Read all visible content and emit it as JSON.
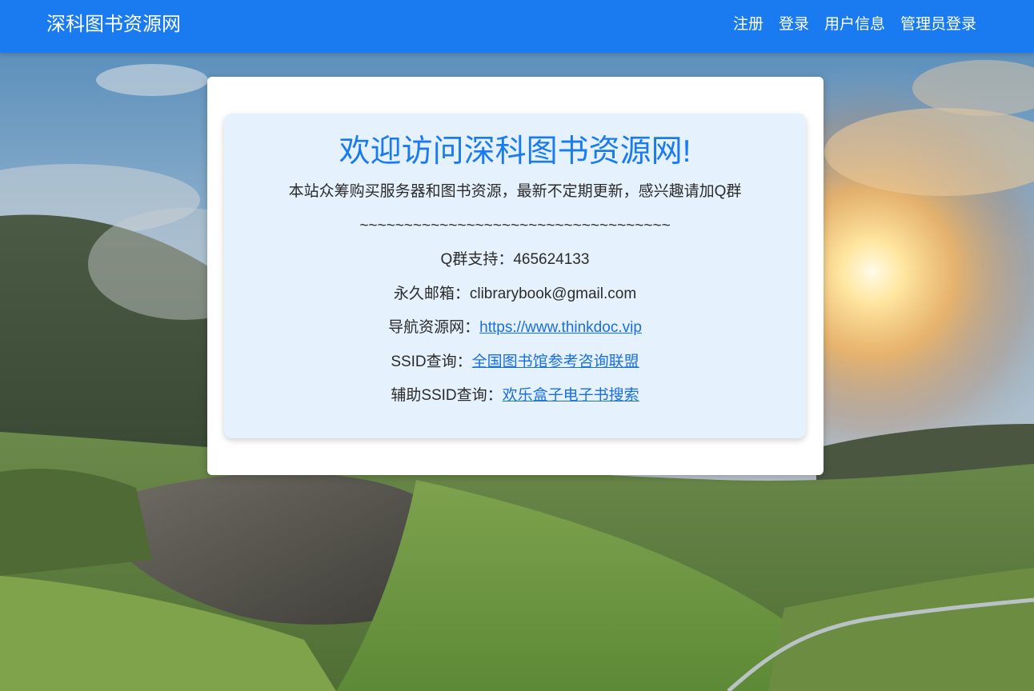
{
  "navbar": {
    "brand": "深科图书资源网",
    "links": [
      "注册",
      "登录",
      "用户信息",
      "管理员登录"
    ]
  },
  "main": {
    "welcome": "欢迎访问深科图书资源网!",
    "intro": "本站众筹购买服务器和图书资源，最新不定期更新，感兴趣请加Q群",
    "separator": "~~~~~~~~~~~~~~~~~~~~~~~~~~~~~~~~~~~",
    "qgroup": {
      "label": "Q群支持：",
      "value": "465624133"
    },
    "email": {
      "label": "永久邮箱：",
      "value": "clibrarybook@gmail.com"
    },
    "nav_site": {
      "label": "导航资源网：",
      "link_text": "https://www.thinkdoc.vip"
    },
    "ssid": {
      "label": "SSID查询：",
      "link_text": "全国图书馆参考咨询联盟"
    },
    "ssid_aux": {
      "label": "辅助SSID查询：",
      "link_text": "欢乐盒子电子书搜索"
    }
  },
  "colors": {
    "navbar": "#1a7bf0",
    "welcome_text": "#1a7bf0",
    "jumbotron": "#e5f1fc",
    "link": "#1a6fe0"
  },
  "background": "mountain-landscape-photo"
}
